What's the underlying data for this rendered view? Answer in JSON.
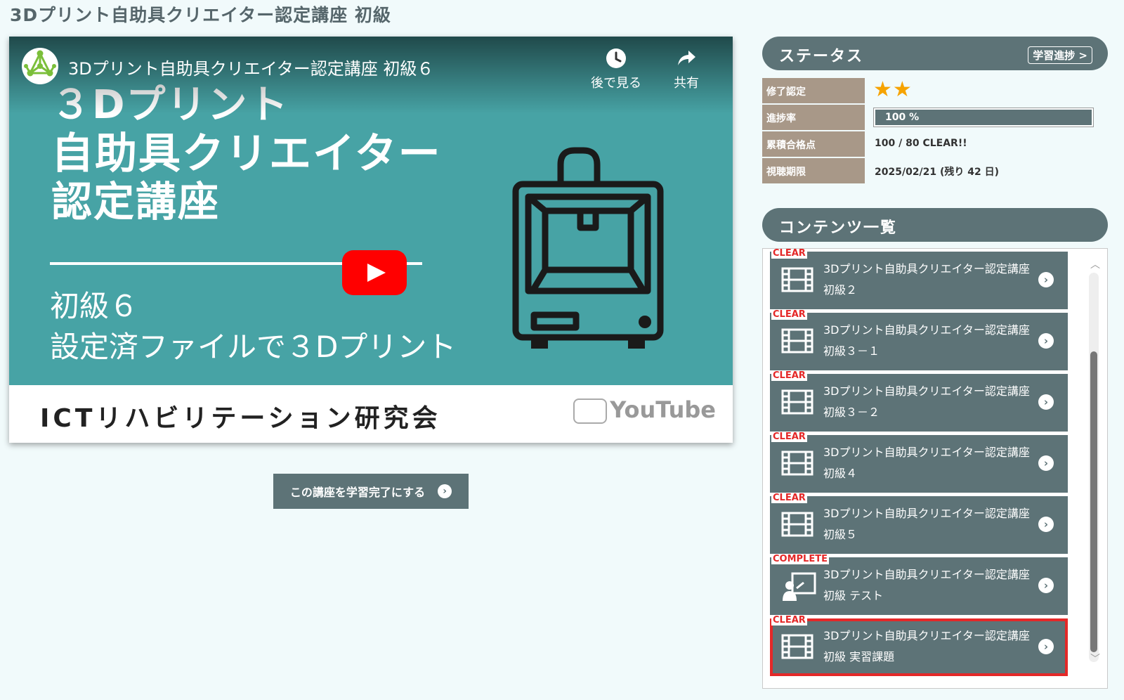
{
  "page": {
    "title": "3Dプリント自助具クリエイター認定講座 初級"
  },
  "video": {
    "title": "3Dプリント自助具クリエイター認定講座 初級６",
    "watch_later": "後で見る",
    "share": "共有",
    "slide": {
      "line1": "３Dプリント",
      "line2": "自助具クリエイター",
      "line3": "認定講座",
      "sub1": "初級６",
      "sub2": "設定済ファイルで３Dプリント",
      "footer": "ICTリハビリテーション研究会",
      "watermark": "YouTube"
    }
  },
  "complete_button": {
    "label": "この講座を学習完了にする"
  },
  "status": {
    "header": "ステータス",
    "progress_link": "学習進捗 >",
    "rows": [
      {
        "label": "修了認定",
        "stars": "★★"
      },
      {
        "label": "進捗率",
        "value": "100 %",
        "progress": 100
      },
      {
        "label": "累積合格点",
        "value": "100 / 80 CLEAR!!"
      },
      {
        "label": "視聴期限",
        "value": "2025/02/21 (残り 42 日)"
      }
    ]
  },
  "contents": {
    "header": "コンテンツ一覧",
    "items": [
      {
        "badge": "CLEAR",
        "title": "3Dプリント自助具クリエイター認定講座 初級２",
        "icon": "film-icon"
      },
      {
        "badge": "CLEAR",
        "title": "3Dプリント自助具クリエイター認定講座 初級３－１",
        "icon": "film-icon"
      },
      {
        "badge": "CLEAR",
        "title": "3Dプリント自助具クリエイター認定講座 初級３－２",
        "icon": "film-icon"
      },
      {
        "badge": "CLEAR",
        "title": "3Dプリント自助具クリエイター認定講座 初級４",
        "icon": "film-icon"
      },
      {
        "badge": "CLEAR",
        "title": "3Dプリント自助具クリエイター認定講座 初級５",
        "icon": "film-icon"
      },
      {
        "badge": "COMPLETE",
        "title": "3Dプリント自助具クリエイター認定講座 初級 テスト",
        "icon": "lecture-icon"
      },
      {
        "badge": "CLEAR",
        "title": "3Dプリント自助具クリエイター認定講座 初級 実習課題",
        "icon": "film-icon"
      }
    ]
  },
  "colors": {
    "accent": "#5d7377",
    "label_bg": "#a89888",
    "badge": "#e42828",
    "star": "#f6a300"
  }
}
